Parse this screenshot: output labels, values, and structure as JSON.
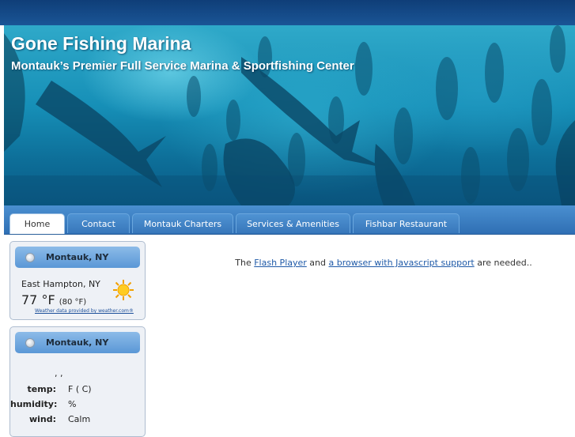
{
  "site": {
    "title": "Gone Fishing Marina",
    "subtitle": "Montauk’s Premier Full Service Marina & Sportfishing Center"
  },
  "nav": {
    "tabs": [
      {
        "label": "Home",
        "active": true
      },
      {
        "label": "Contact",
        "active": false
      },
      {
        "label": "Montauk Charters",
        "active": false
      },
      {
        "label": "Services & Amenities",
        "active": false
      },
      {
        "label": "Fishbar Restaurant",
        "active": false
      }
    ]
  },
  "weather_widget": {
    "title": "Montauk, NY",
    "location": "East Hampton, NY",
    "temp": "77 °F",
    "feels_like": "(80 °F)",
    "icon": "sun-icon",
    "credit": "Weather data provided by weather.com®"
  },
  "conditions_widget": {
    "title": "Montauk, NY",
    "separator": ", ,",
    "rows": [
      {
        "label": "temp:",
        "value": "F ( C)"
      },
      {
        "label": "humidity:",
        "value": "%"
      },
      {
        "label": "wind:",
        "value": "Calm"
      }
    ]
  },
  "main": {
    "flash_prefix": "The ",
    "flash_link": "Flash Player",
    "flash_mid": " and ",
    "browser_link": "a browser with Javascript support",
    "flash_suffix": " are needed.."
  },
  "colors": {
    "topbar": "#0f3e78",
    "nav": "#3877bb",
    "water": "#168fb7",
    "link": "#1f5aa8"
  }
}
